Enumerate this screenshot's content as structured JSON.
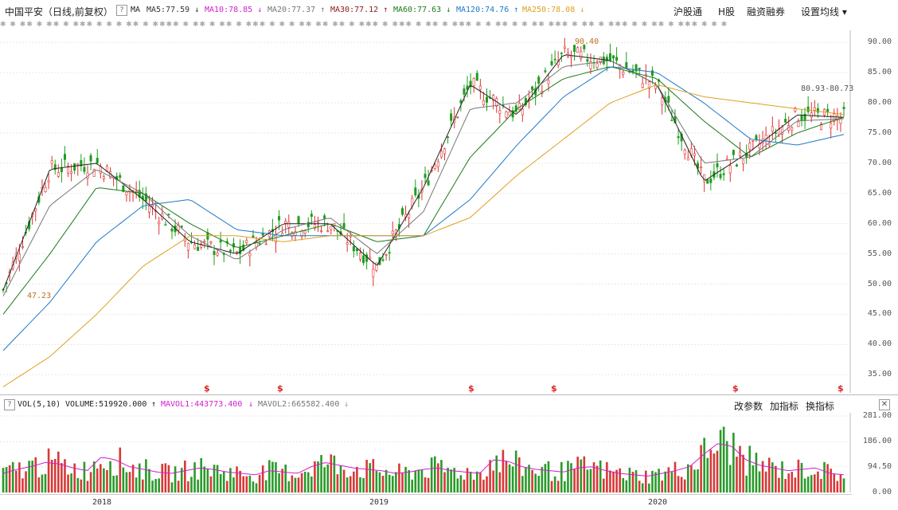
{
  "header": {
    "title": "中国平安（日线,前复权）",
    "help": "?",
    "ma_label": "MA",
    "ma": [
      {
        "label": "MA5:77.59",
        "arrow": "↓",
        "color": "#222222"
      },
      {
        "label": "MA10:78.85",
        "arrow": "↓",
        "color": "#d01fd0"
      },
      {
        "label": "MA20:77.37",
        "arrow": "↑",
        "color": "#777777"
      },
      {
        "label": "MA30:77.12",
        "arrow": "↑",
        "color": "#8b1a1a"
      },
      {
        "label": "MA60:77.63",
        "arrow": "↓",
        "color": "#1a7a1a"
      },
      {
        "label": "MA120:74.76",
        "arrow": "↑",
        "color": "#1f78c8"
      },
      {
        "label": "MA250:78.08",
        "arrow": "↓",
        "color": "#e0a020"
      }
    ],
    "menu": [
      "沪股通",
      "H股",
      "融资融券",
      "设置均线 ▾"
    ]
  },
  "price_axis": [
    "90.00",
    "85.00",
    "80.00",
    "75.00",
    "70.00",
    "65.00",
    "60.00",
    "55.00",
    "50.00",
    "45.00",
    "40.00",
    "35.00"
  ],
  "annotations": {
    "high": "90.40",
    "low": "47.23",
    "range": "80.93-80.73"
  },
  "volume_header": {
    "help": "?",
    "vol": "VOL(5,10)",
    "volume": "VOLUME:519920.000",
    "mavol1": "MAVOL1:443773.400",
    "mavol1_arrow": "↑",
    "mavol2": "MAVOL2:665582.400",
    "mavol2_arrow": "↓",
    "menu": [
      "改参数",
      "加指标",
      "换指标"
    ],
    "close": "✕"
  },
  "volume_axis": [
    "281.00",
    "186.00",
    "94.50",
    "0.00"
  ],
  "x_axis": [
    "2018",
    "2019",
    "2020"
  ],
  "dividend_marker": "$",
  "chart_data": {
    "type": "line",
    "title": "中国平安（日线,前复权）",
    "ylim": [
      32,
      92
    ],
    "x": [
      "2017-11",
      "2018-01",
      "2018-03",
      "2018-05",
      "2018-07",
      "2018-09",
      "2018-11",
      "2019-01",
      "2019-03",
      "2019-05",
      "2019-07",
      "2019-09",
      "2019-11",
      "2020-01",
      "2020-03",
      "2020-05",
      "2020-07",
      "2020-09",
      "2020-11"
    ],
    "series": [
      {
        "name": "MA5",
        "color": "#222222",
        "values": [
          49,
          69,
          70,
          64,
          57,
          55,
          60,
          60,
          53,
          66,
          83,
          78,
          88,
          87,
          83,
          67,
          72,
          78,
          77.59
        ]
      },
      {
        "name": "MA20",
        "color": "#777777",
        "values": [
          48,
          63,
          69,
          65,
          58,
          54,
          59,
          61,
          55,
          62,
          79,
          80,
          86,
          87,
          83,
          70,
          71,
          77,
          77.37
        ]
      },
      {
        "name": "MA60",
        "color": "#1a7a1a",
        "values": [
          45,
          55,
          66,
          65,
          60,
          56,
          58,
          60,
          57,
          58,
          71,
          79,
          84,
          86,
          84,
          77,
          71,
          75,
          77.63
        ]
      },
      {
        "name": "MA120",
        "color": "#1f78c8",
        "values": [
          39,
          47,
          57,
          63,
          64,
          59,
          58,
          58,
          58,
          58,
          64,
          73,
          81,
          86,
          85,
          80,
          74,
          73,
          74.76
        ]
      },
      {
        "name": "MA250",
        "color": "#e0a020",
        "values": [
          33,
          38,
          45,
          53,
          58,
          58,
          57,
          58,
          58,
          58,
          61,
          68,
          74,
          80,
          83,
          81,
          80,
          79,
          78.08
        ]
      }
    ],
    "volume_ylim": [
      0,
      281
    ],
    "volume_values": [
      70,
      85,
      95,
      110,
      105,
      90,
      80,
      130,
      120,
      95,
      85,
      75,
      70,
      80,
      90,
      85,
      75,
      70,
      65,
      80,
      75,
      70,
      95,
      110,
      100,
      90,
      85,
      80,
      70,
      75,
      85,
      90,
      80,
      75,
      70,
      120,
      115,
      95,
      85,
      80,
      75,
      90,
      95,
      80,
      70,
      65,
      60,
      70,
      80,
      95,
      140,
      180,
      170,
      120,
      100,
      90,
      80,
      85,
      90,
      70,
      65
    ]
  }
}
